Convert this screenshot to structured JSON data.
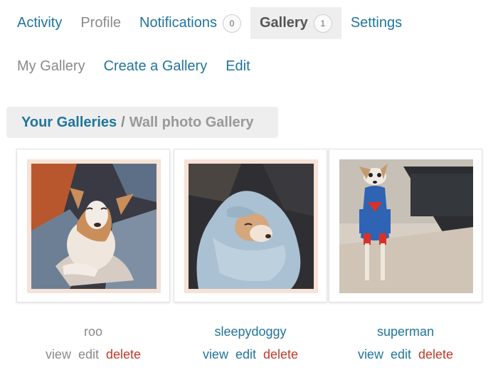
{
  "tabs": [
    {
      "label": "Activity"
    },
    {
      "label": "Profile"
    },
    {
      "label": "Notifications",
      "count": "0"
    },
    {
      "label": "Gallery",
      "count": "1"
    },
    {
      "label": "Settings"
    }
  ],
  "subnav": [
    {
      "label": "My Gallery"
    },
    {
      "label": "Create a Gallery"
    },
    {
      "label": "Edit"
    }
  ],
  "breadcrumb": {
    "parent": "Your Galleries",
    "separator": "/",
    "current": "Wall photo Gallery"
  },
  "photos": [
    {
      "title": "roo",
      "view": "view",
      "edit": "edit",
      "delete": "delete",
      "image": "dog-smiling-on-blanket"
    },
    {
      "title": "sleepydoggy",
      "view": "view",
      "edit": "edit",
      "delete": "delete",
      "image": "dog-wrapped-in-blanket"
    },
    {
      "title": "superman",
      "view": "view",
      "edit": "edit",
      "delete": "delete",
      "image": "dog-in-superman-sweater"
    }
  ],
  "colors": {
    "link": "#21759b",
    "muted": "#8a8a8a",
    "delete": "#c0392b",
    "active_tab_bg": "#eeeeee"
  }
}
